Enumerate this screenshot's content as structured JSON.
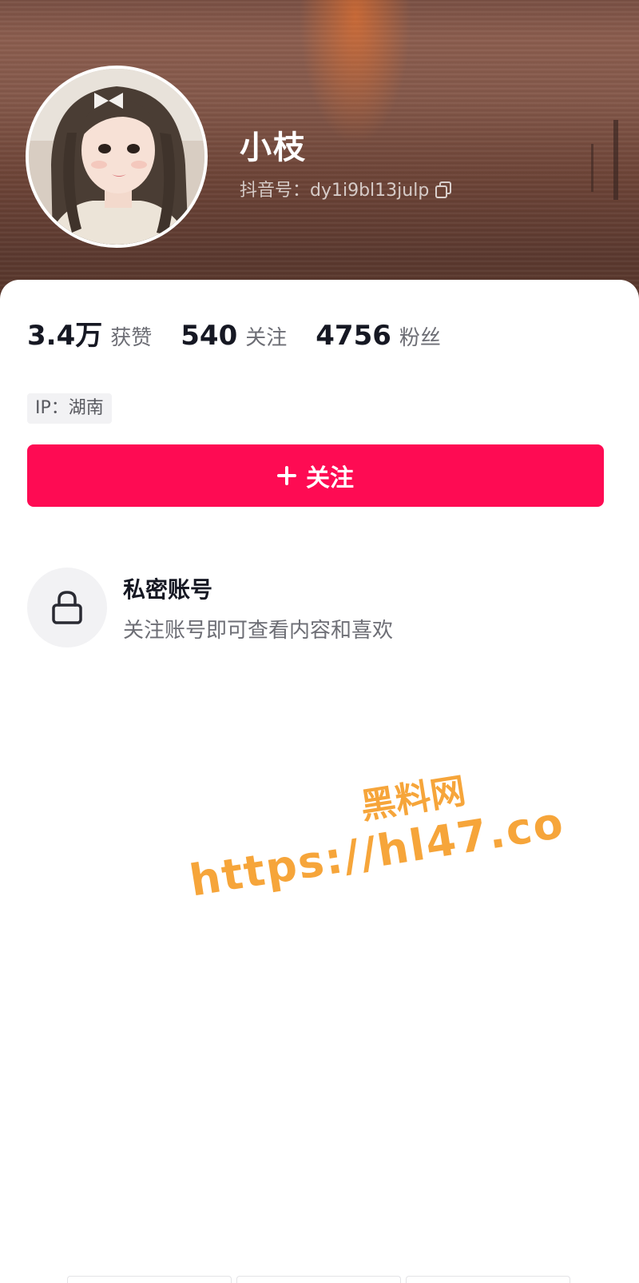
{
  "profile": {
    "nickname": "小枝",
    "douyin_id": "抖音号：dy1i9bl13julp"
  },
  "stats": [
    {
      "value": "3.4万",
      "label": "获赞"
    },
    {
      "value": "540",
      "label": "关注"
    },
    {
      "value": "4756",
      "label": "粉丝"
    }
  ],
  "ip_location": "IP：湖南",
  "follow_button": {
    "label": "关注"
  },
  "private_account": {
    "title": "私密账号",
    "description": "关注账号即可查看内容和喜欢"
  },
  "watermark": {
    "title": "黑料网",
    "url": "https://hl47.co"
  },
  "colors": {
    "accent": "#fe0b53",
    "watermark": "#f6a53a",
    "primary_text": "#161823",
    "secondary_text": "#6d6e75"
  },
  "icons": [
    "copy-icon",
    "plus-icon",
    "lock-icon"
  ]
}
